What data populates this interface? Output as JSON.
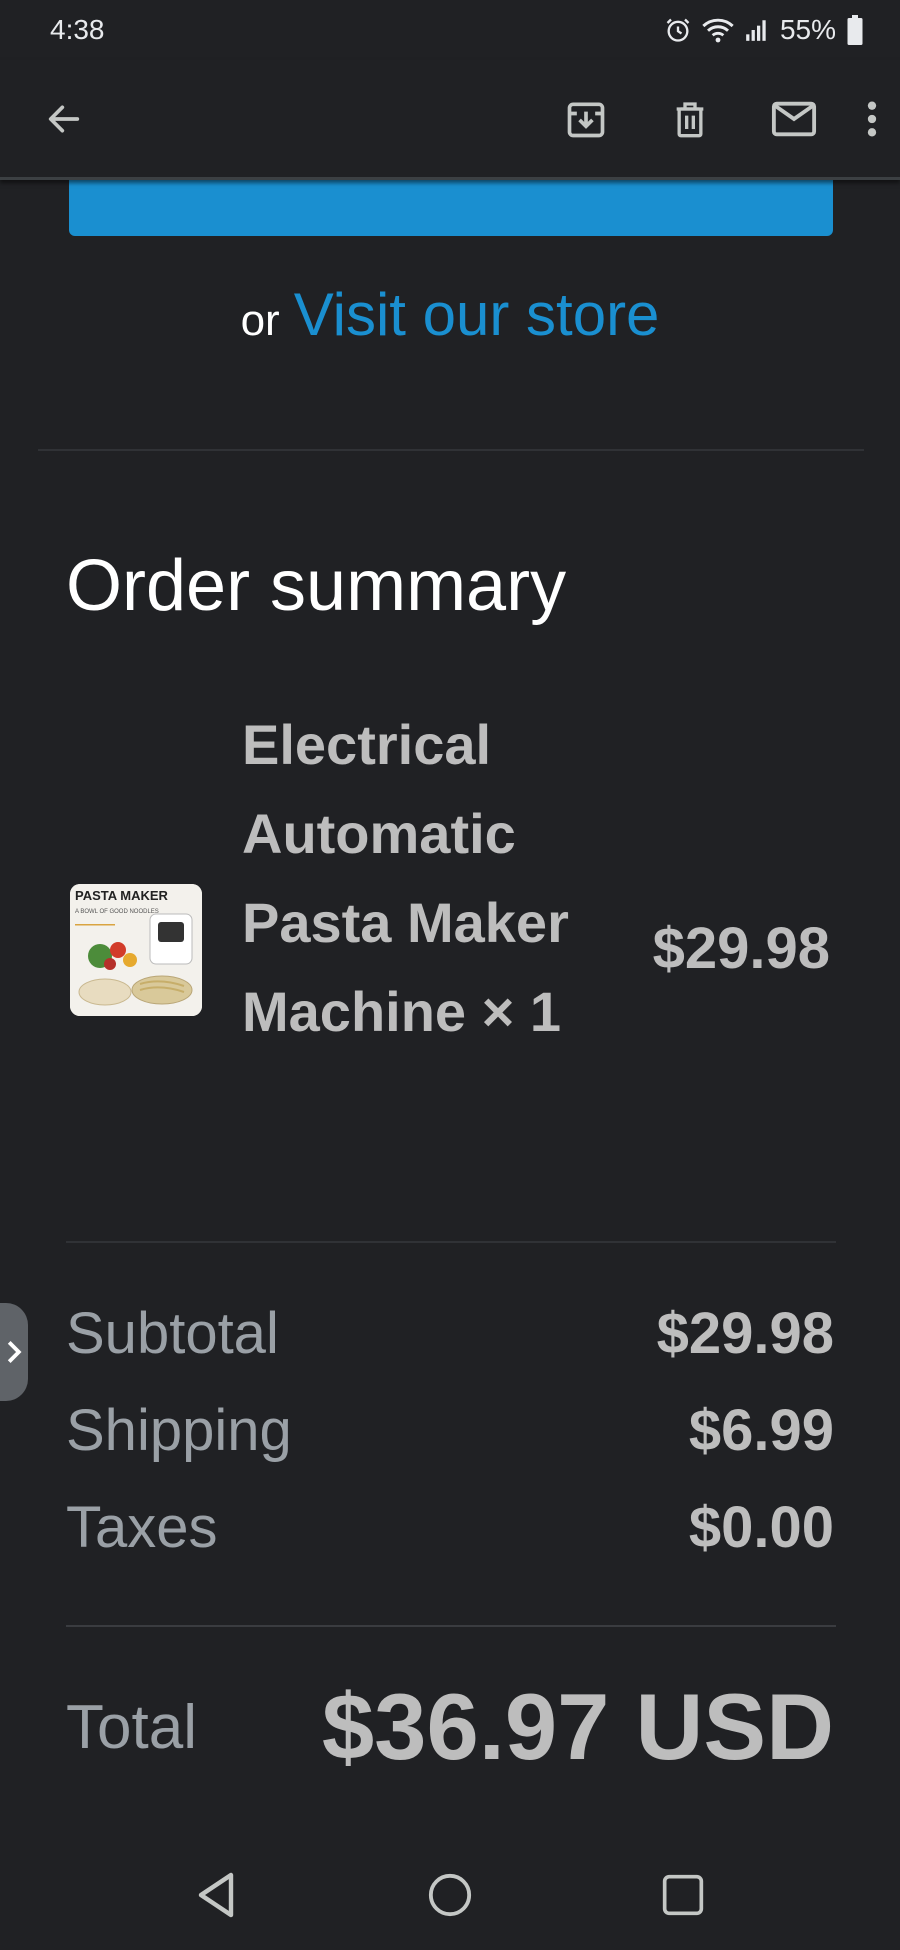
{
  "status_bar": {
    "time": "4:38",
    "battery": "55%",
    "icons": [
      "alarm-icon",
      "wifi-icon",
      "signal-icon",
      "battery-icon"
    ]
  },
  "app_bar": {
    "icons": [
      "back-arrow-icon",
      "archive-icon",
      "trash-icon",
      "mail-icon",
      "more-vert-icon"
    ]
  },
  "email": {
    "store_prefix": "or",
    "store_link": "Visit our store",
    "order_summary_title": "Order summary",
    "item": {
      "image_text": "PASTA MAKER",
      "image_subtext": "A BOWL OF GOOD NOODLES",
      "name": "Electrical Automatic Pasta Maker Machine × 1",
      "price": "$29.98"
    },
    "totals": {
      "subtotal_label": "Subtotal",
      "subtotal_value": "$29.98",
      "shipping_label": "Shipping",
      "shipping_value": "$6.99",
      "taxes_label": "Taxes",
      "taxes_value": "$0.00",
      "total_label": "Total",
      "total_value": "$36.97 USD"
    }
  },
  "colors": {
    "background": "#202124",
    "link": "#1a8fd0",
    "button": "#1a8fd0",
    "muted_text": "#9aa0a6",
    "value_text": "#bdbdbd"
  },
  "nav_bar": {
    "icons": [
      "back-triangle-icon",
      "home-circle-icon",
      "recents-square-icon"
    ]
  }
}
